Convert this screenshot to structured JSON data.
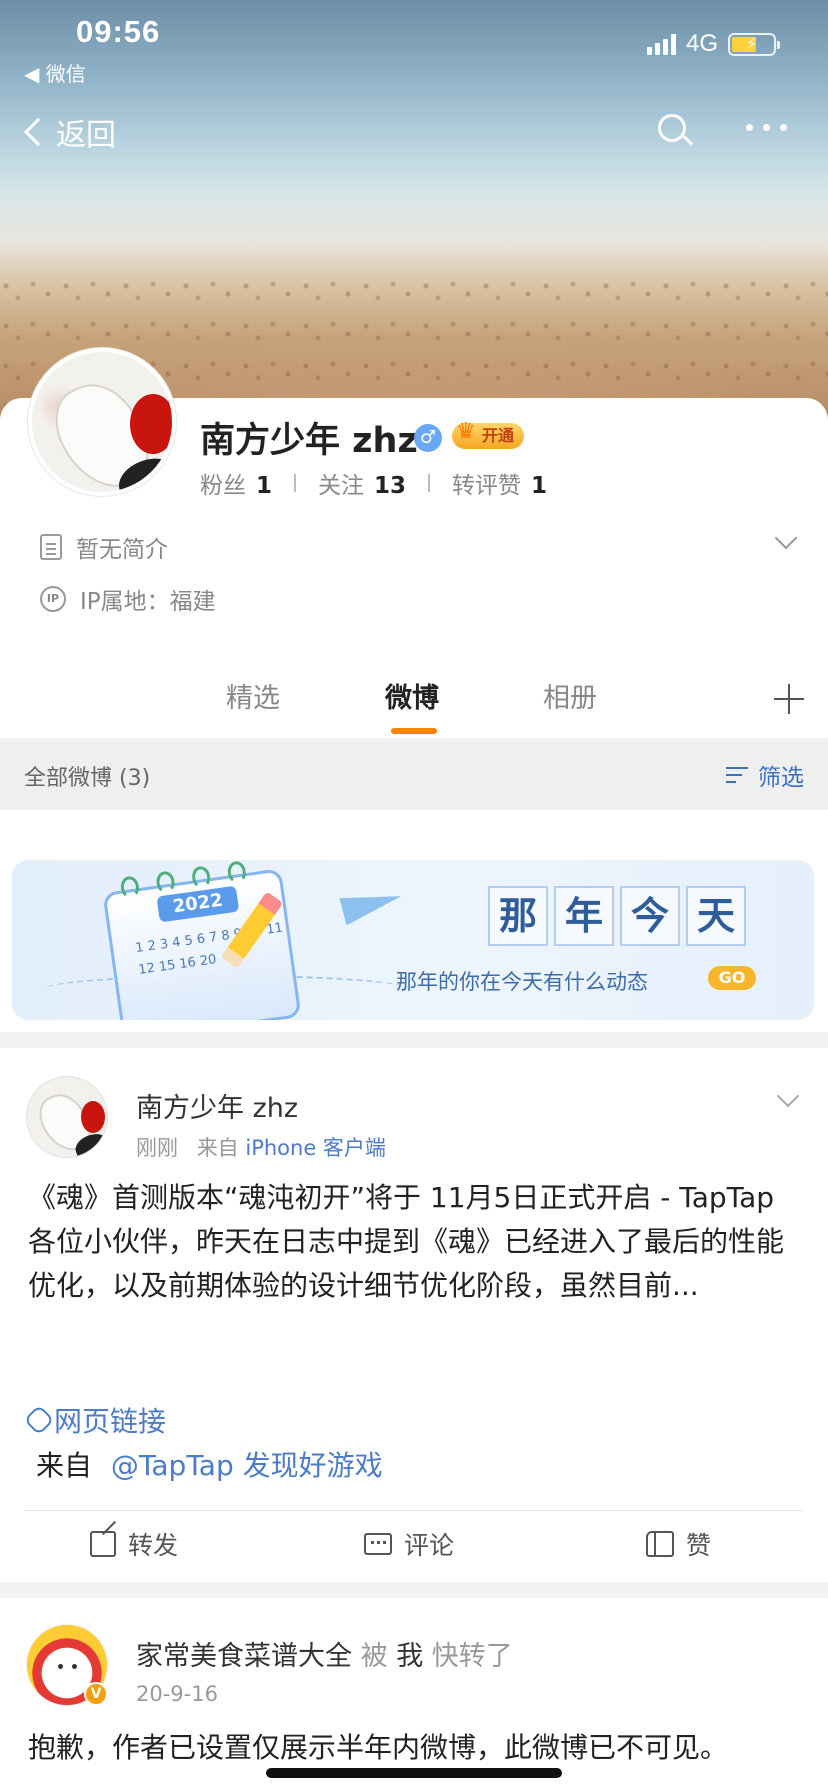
{
  "status_bar": {
    "time": "09:56",
    "back_app": "◀ 微信",
    "network": "4G"
  },
  "nav": {
    "back_label": "返回"
  },
  "profile": {
    "name": "南方少年 zhz",
    "gender_icon": "♂",
    "vip_label": "开通",
    "stats": [
      {
        "label": "粉丝",
        "value": "1"
      },
      {
        "label": "关注",
        "value": "13"
      },
      {
        "label": "转评赞",
        "value": "1"
      }
    ],
    "bio": "暂无简介",
    "ip_location": "IP属地：福建"
  },
  "tabs": [
    {
      "label": "精选",
      "active": false
    },
    {
      "label": "微博",
      "active": true
    },
    {
      "label": "相册",
      "active": false
    }
  ],
  "filter": {
    "count_label": "全部微博 (3)",
    "filter_label": "筛选"
  },
  "banner": {
    "calendar_year": "2022",
    "calendar_nums": "1 2 3 4 5 6 7 8 9 10 11 12 15 16 20",
    "title_chars": [
      "那",
      "年",
      "今",
      "天"
    ],
    "subtitle": "那年的你在今天有什么动态",
    "go_label": "GO"
  },
  "post1": {
    "author": "南方少年 zhz",
    "time": "刚刚",
    "source_prefix": "来自",
    "source": "iPhone 客户端",
    "text": "《魂》首测版本“魂沌初开”将于 11月5日正式开启 - TapTap\n各位小伙伴，昨天在日志中提到《魂》已经进入了最后的性能优化，以及前期体验的设计细节优化阶段，虽然目前...",
    "link_label": "网页链接",
    "via_prefix": "来自",
    "via_mention": "@TapTap 发现好游戏",
    "actions": {
      "repost": "转发",
      "comment": "评论",
      "like": "赞"
    }
  },
  "post2": {
    "author": "家常美食菜谱大全",
    "by_label": "被",
    "me_label": "我",
    "action_label": "快转了",
    "date": "20-9-16",
    "notice": "抱歉，作者已设置仅展示半年内微博，此微博已不可见。"
  },
  "colors": {
    "accent_orange": "#ff8200",
    "link_blue": "#4b7bc9",
    "vip_gold": "#f5a623"
  }
}
